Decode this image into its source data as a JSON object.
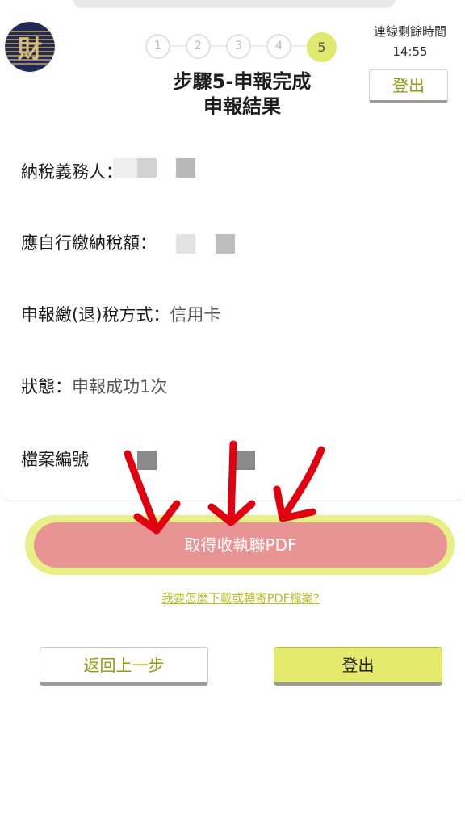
{
  "header": {
    "steps": [
      "1",
      "2",
      "3",
      "4",
      "5"
    ],
    "active_step": "5",
    "timer_label": "連線剩餘時間",
    "timer_value": "14:55",
    "title_line1": "步驟5-申報完成",
    "title_line2": "申報結果",
    "logout_label": "登出"
  },
  "result": {
    "taxpayer_label": "納稅義務人：",
    "tax_due_label": "應自行繳納稅額：",
    "payment_method_label": "申報繳(退)稅方式：",
    "payment_method_value": "信用卡",
    "status_label": "狀態：",
    "status_value": "申報成功1次",
    "file_no_label": "檔案編號"
  },
  "actions": {
    "pdf_button_label": "取得收執聯PDF",
    "help_link": "我要怎麼下載或轉寄PDF檔案?",
    "back_label": "返回上一步",
    "logout_label": "登出"
  },
  "colors": {
    "accent_yellow": "#dfe86f",
    "accent_text": "#8e9b13",
    "pdf_button": "#e89494",
    "annotation_arrows": "#e0000f"
  }
}
